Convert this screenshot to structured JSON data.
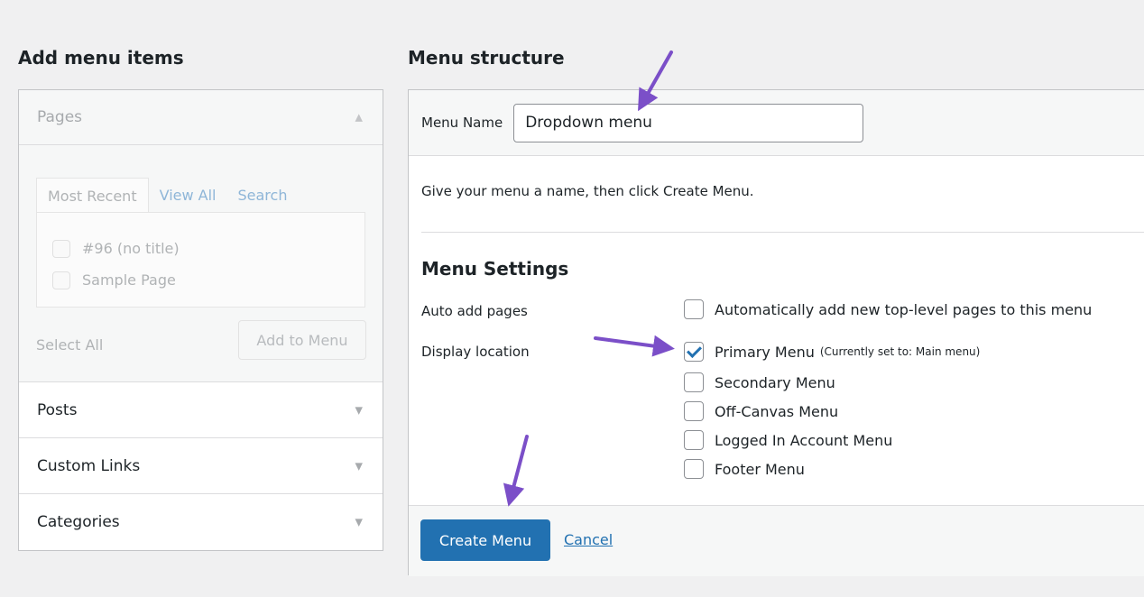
{
  "left": {
    "heading": "Add menu items",
    "sections": [
      {
        "label": "Pages"
      },
      {
        "label": "Posts"
      },
      {
        "label": "Custom Links"
      },
      {
        "label": "Categories"
      }
    ],
    "tabs": [
      "Most Recent",
      "View All",
      "Search"
    ],
    "pages": [
      "#96 (no title)",
      "Sample Page"
    ],
    "select_all": "Select All",
    "add_button": "Add to Menu"
  },
  "right": {
    "heading": "Menu structure",
    "menu_name_label": "Menu Name",
    "menu_name_value": "Dropdown menu",
    "help_text": "Give your menu a name, then click Create Menu.",
    "settings_title": "Menu Settings",
    "auto_add_label": "Auto add pages",
    "auto_add_option": "Automatically add new top-level pages to this menu",
    "display_location_label": "Display location",
    "locations": [
      {
        "label": "Primary Menu",
        "note": "(Currently set to: Main menu)",
        "checked": true
      },
      {
        "label": "Secondary Menu",
        "checked": false
      },
      {
        "label": "Off-Canvas Menu",
        "checked": false
      },
      {
        "label": "Logged In Account Menu",
        "checked": false
      },
      {
        "label": "Footer Menu",
        "checked": false
      }
    ],
    "create_button": "Create Menu",
    "cancel_link": "Cancel"
  },
  "colors": {
    "accent": "#2271b1",
    "annotation_arrow": "#7b4fc8"
  }
}
